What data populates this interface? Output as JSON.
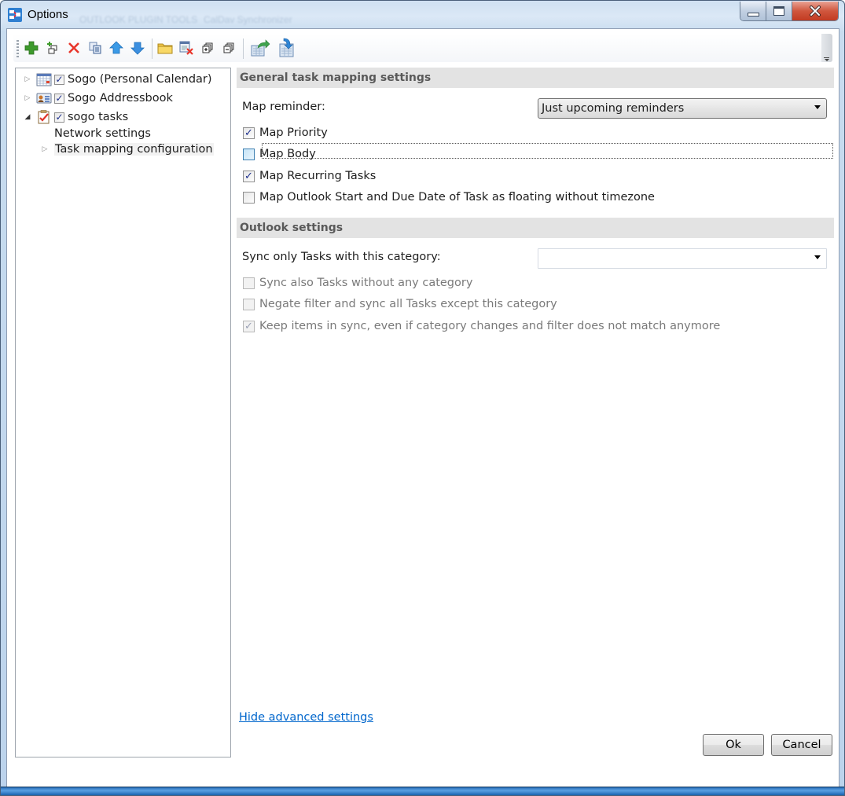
{
  "window": {
    "title": "Options",
    "background_ghost_tabs": [
      "OUTLOOK PLUGIN TOOLS",
      "CalDav Synchronizer"
    ],
    "caption_buttons": [
      "minimize",
      "maximize",
      "close"
    ]
  },
  "toolbar": {
    "buttons": [
      {
        "name": "add-profile",
        "icon": "green-plus-icon"
      },
      {
        "name": "add-multiple-profiles",
        "icon": "plus-copy-icon"
      },
      {
        "name": "delete-profile",
        "icon": "red-x-icon"
      },
      {
        "name": "copy-profile",
        "icon": "copy-icon"
      },
      {
        "name": "move-up",
        "icon": "blue-up-arrow-icon"
      },
      {
        "name": "move-down",
        "icon": "blue-down-arrow-icon"
      },
      {
        "name": "open-data-directory",
        "icon": "folder-icon"
      },
      {
        "name": "clear-cache",
        "icon": "clear-cache-icon"
      },
      {
        "name": "expand-all",
        "icon": "expand-all-icon"
      },
      {
        "name": "collapse-all",
        "icon": "collapse-all-icon"
      },
      {
        "name": "export-options",
        "icon": "export-icon"
      },
      {
        "name": "import-options",
        "icon": "import-icon"
      }
    ]
  },
  "tree": {
    "items": [
      {
        "label": "Sogo (Personal Calendar)",
        "icon": "calendar-icon",
        "checked": true,
        "expanded": false
      },
      {
        "label": "Sogo Addressbook",
        "icon": "addressbook-icon",
        "checked": true,
        "expanded": false
      },
      {
        "label": "sogo tasks",
        "icon": "tasks-icon",
        "checked": true,
        "expanded": true,
        "children": [
          {
            "label": "Network settings"
          },
          {
            "label": "Task mapping configuration",
            "selected": true,
            "expandable": true
          }
        ]
      }
    ]
  },
  "general_section": {
    "header": "General task mapping settings",
    "map_reminder_label": "Map reminder:",
    "map_reminder_value": "Just upcoming reminders",
    "checkboxes": [
      {
        "label": "Map Priority",
        "checked": true
      },
      {
        "label": "Map Body",
        "checked": false,
        "focused": true
      },
      {
        "label": "Map Recurring Tasks",
        "checked": true
      },
      {
        "label": "Map Outlook Start and Due Date of Task as floating without timezone",
        "checked": false
      }
    ]
  },
  "outlook_section": {
    "header": "Outlook settings",
    "category_label": "Sync only Tasks with this category:",
    "category_value": "",
    "checkboxes": [
      {
        "label": "Sync also Tasks without any category",
        "checked": false,
        "enabled": false
      },
      {
        "label": "Negate filter and sync all Tasks except this category",
        "checked": false,
        "enabled": false
      },
      {
        "label": "Keep items in sync, even if category changes and filter does not match anymore",
        "checked": true,
        "enabled": false
      }
    ]
  },
  "footer": {
    "advanced_link": "Hide advanced settings",
    "ok_label": "Ok",
    "cancel_label": "Cancel"
  }
}
